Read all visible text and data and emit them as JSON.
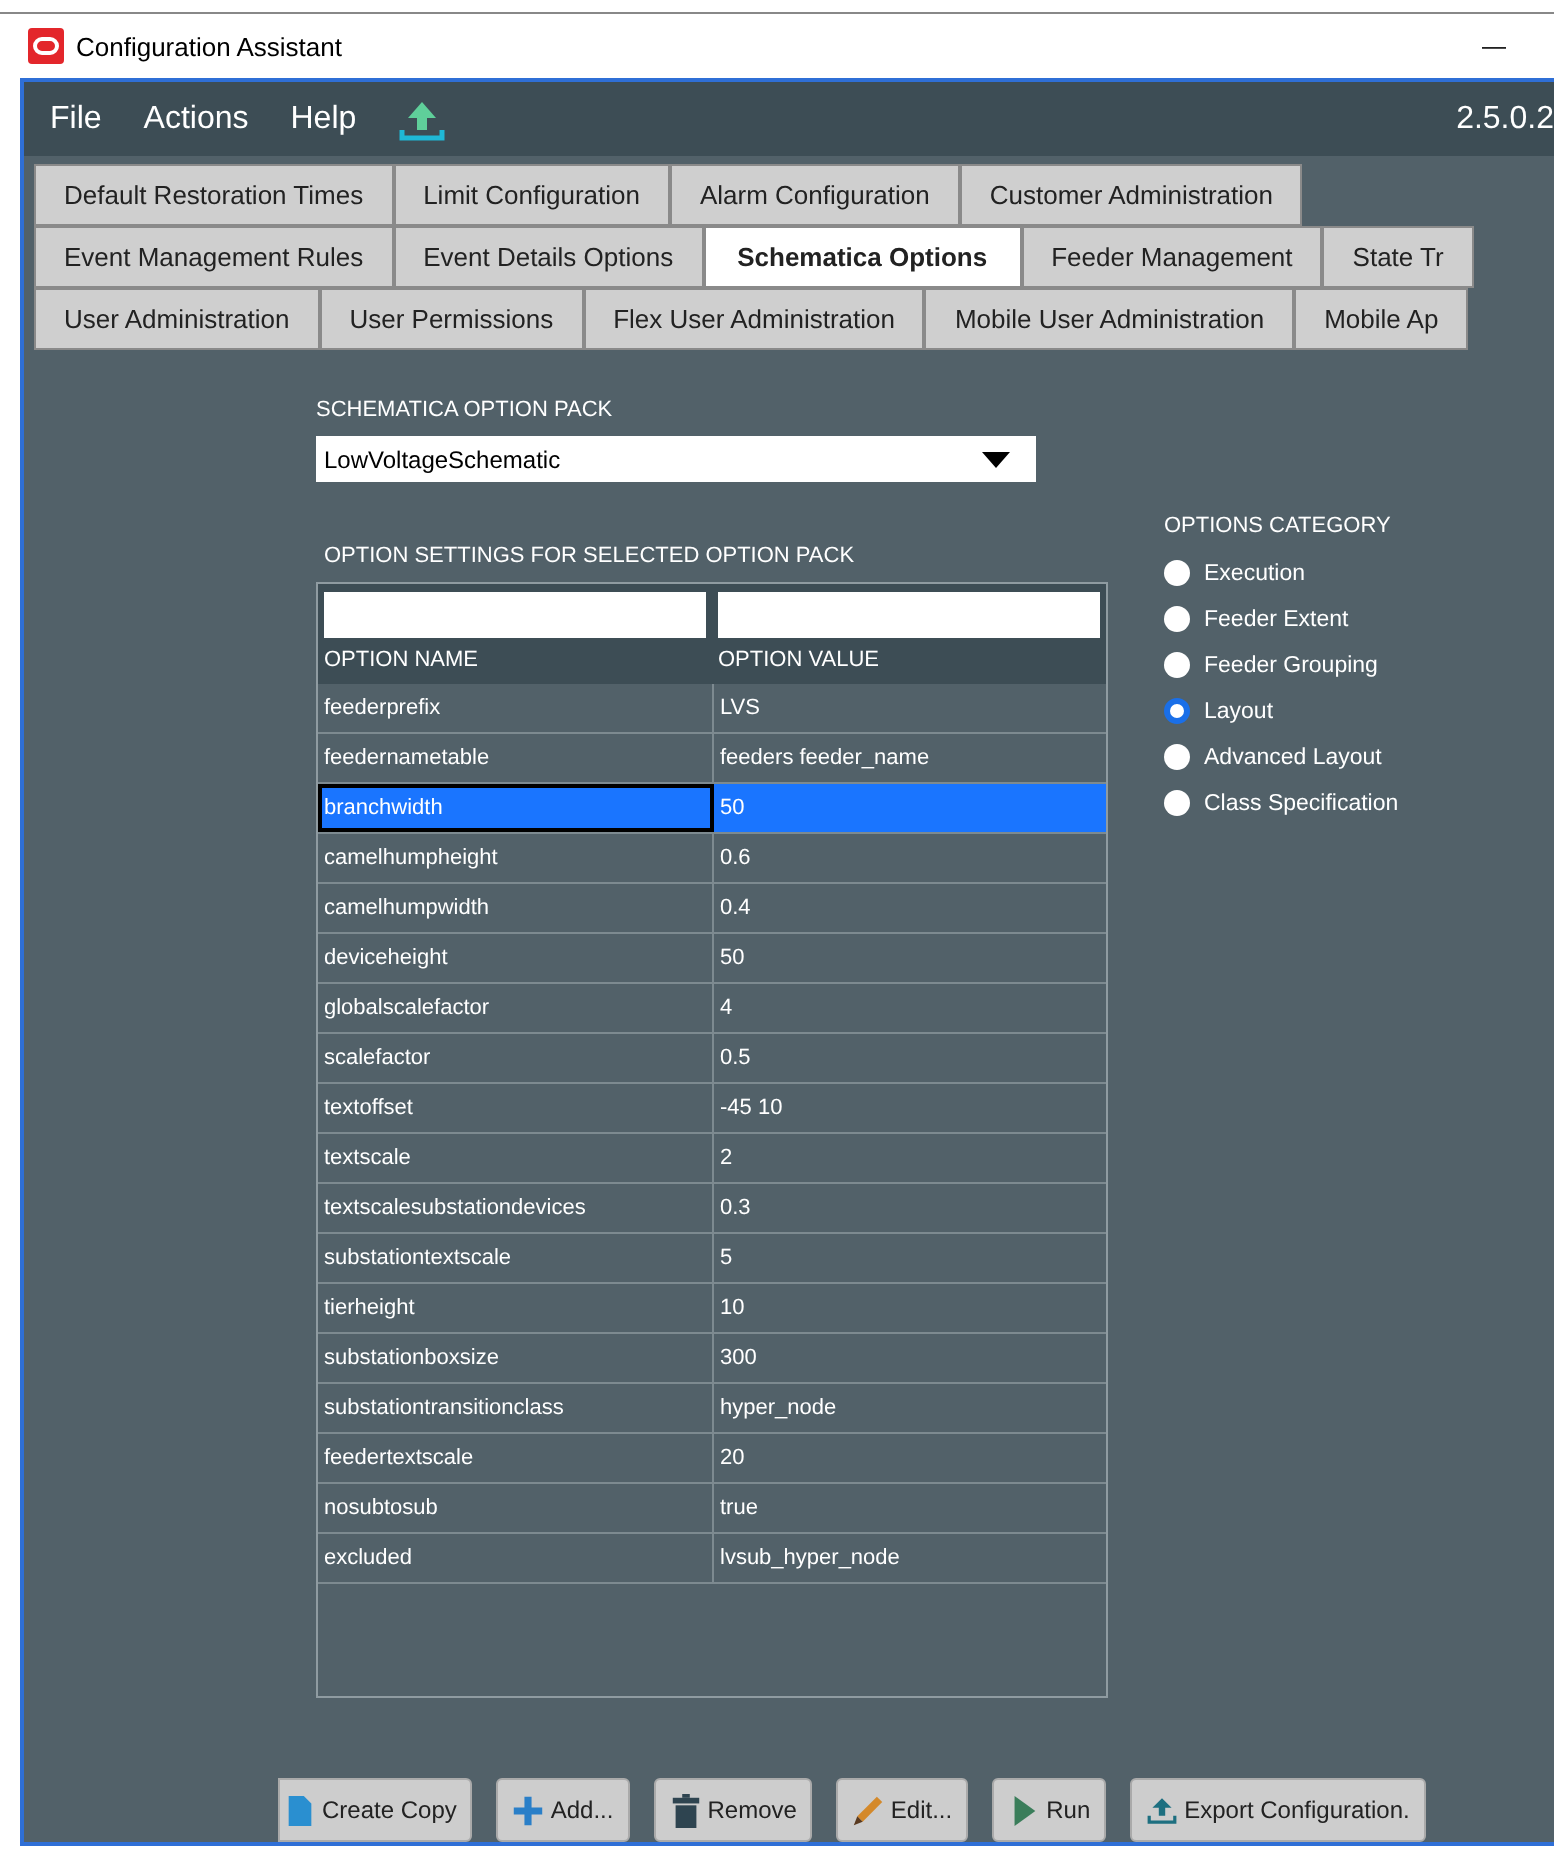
{
  "window": {
    "title": "Configuration Assistant",
    "minimize": "—"
  },
  "menu": [
    "File",
    "Actions",
    "Help"
  ],
  "version": "2.5.0.2",
  "tab_rows": [
    [
      {
        "label": "Default Restoration Times",
        "selected": false
      },
      {
        "label": "Limit Configuration",
        "selected": false
      },
      {
        "label": "Alarm Configuration",
        "selected": false
      },
      {
        "label": "Customer Administration",
        "selected": false
      }
    ],
    [
      {
        "label": "Event Management Rules",
        "selected": false
      },
      {
        "label": "Event Details Options",
        "selected": false
      },
      {
        "label": "Schematica Options",
        "selected": true
      },
      {
        "label": "Feeder Management",
        "selected": false
      },
      {
        "label": "State Tr",
        "selected": false
      }
    ],
    [
      {
        "label": "User Administration",
        "selected": false
      },
      {
        "label": "User Permissions",
        "selected": false
      },
      {
        "label": "Flex User Administration",
        "selected": false
      },
      {
        "label": "Mobile User Administration",
        "selected": false
      },
      {
        "label": "Mobile Ap",
        "selected": false
      }
    ]
  ],
  "option_pack": {
    "label": "SCHEMATICA OPTION PACK",
    "value": "LowVoltageSchematic"
  },
  "table": {
    "title": "OPTION SETTINGS FOR SELECTED OPTION PACK",
    "columns": [
      "OPTION NAME",
      "OPTION VALUE"
    ],
    "rows": [
      {
        "name": "feederprefix",
        "value": "LVS",
        "selected": false
      },
      {
        "name": "feedernametable",
        "value": "feeders feeder_name",
        "selected": false
      },
      {
        "name": "branchwidth",
        "value": "50",
        "selected": true
      },
      {
        "name": "camelhumpheight",
        "value": "0.6",
        "selected": false
      },
      {
        "name": "camelhumpwidth",
        "value": "0.4",
        "selected": false
      },
      {
        "name": "deviceheight",
        "value": "50",
        "selected": false
      },
      {
        "name": "globalscalefactor",
        "value": "4",
        "selected": false
      },
      {
        "name": "scalefactor",
        "value": "0.5",
        "selected": false
      },
      {
        "name": "textoffset",
        "value": "-45 10",
        "selected": false
      },
      {
        "name": "textscale",
        "value": "2",
        "selected": false
      },
      {
        "name": "textscalesubstationdevices",
        "value": "0.3",
        "selected": false
      },
      {
        "name": "substationtextscale",
        "value": "5",
        "selected": false
      },
      {
        "name": "tierheight",
        "value": "10",
        "selected": false
      },
      {
        "name": "substationboxsize",
        "value": "300",
        "selected": false
      },
      {
        "name": "substationtransitionclass",
        "value": "hyper_node",
        "selected": false
      },
      {
        "name": "feedertextscale",
        "value": "20",
        "selected": false
      },
      {
        "name": "nosubtosub",
        "value": "true",
        "selected": false
      },
      {
        "name": "excluded",
        "value": "lvsub_hyper_node",
        "selected": false
      }
    ]
  },
  "options_category": {
    "label": "OPTIONS CATEGORY",
    "options": [
      {
        "label": "Execution",
        "selected": false
      },
      {
        "label": "Feeder Extent",
        "selected": false
      },
      {
        "label": "Feeder Grouping",
        "selected": false
      },
      {
        "label": "Layout",
        "selected": true
      },
      {
        "label": "Advanced Layout",
        "selected": false
      },
      {
        "label": "Class Specification",
        "selected": false
      }
    ]
  },
  "buttons": [
    {
      "kind": "copy",
      "label": "Create Copy"
    },
    {
      "kind": "add",
      "label": "Add..."
    },
    {
      "kind": "remove",
      "label": "Remove"
    },
    {
      "kind": "edit",
      "label": "Edit..."
    },
    {
      "kind": "run",
      "label": "Run"
    },
    {
      "kind": "export",
      "label": "Export Configuration."
    }
  ]
}
